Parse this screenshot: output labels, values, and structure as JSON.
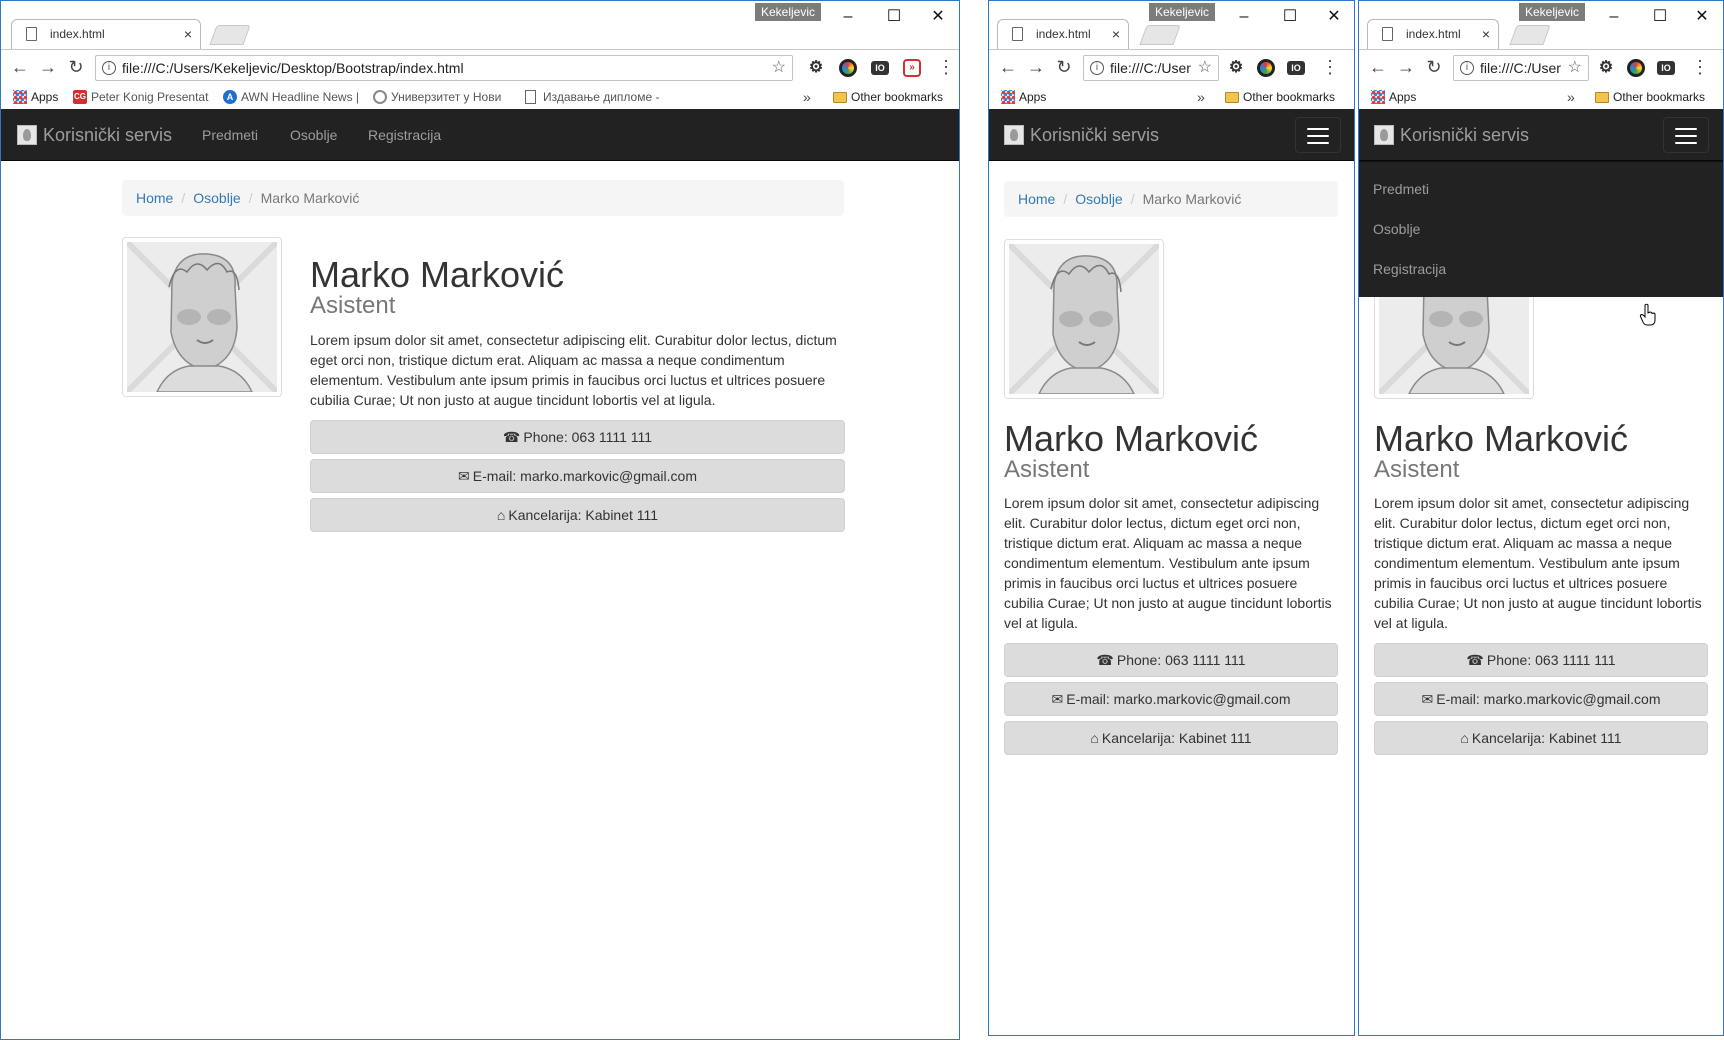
{
  "browser": {
    "profile_name": "Kekeljevic",
    "tab_title": "index.html",
    "url_full": "file:///C:/Users/Kekeljevic/Desktop/Bootstrap/index.html",
    "url_short": "file:///C:/User",
    "bookmarks": [
      "Apps",
      "Peter Konig Presentat",
      "AWN Headline News |",
      "Универзитет у Нови",
      "Издавање дипломе -"
    ],
    "other_bookmarks": "Other bookmarks",
    "more_chevron": "»"
  },
  "site": {
    "brand": "Korisnički servis",
    "nav": [
      "Predmeti",
      "Osoblje",
      "Registracija"
    ],
    "breadcrumb": [
      "Home",
      "Osoblje",
      "Marko Marković"
    ],
    "breadcrumb_separator": "/",
    "profile": {
      "name": "Marko Marković",
      "role": "Asistent",
      "bio": "Lorem ipsum dolor sit amet, consectetur adipiscing elit. Curabitur dolor lectus, dictum eget orci non, tristique dictum erat. Aliquam ac massa a neque condimentum elementum. Vestibulum ante ipsum primis in faucibus orci luctus et ultrices posuere cubilia Curae; Ut non justo at augue tincidunt lobortis vel at ligula.",
      "contacts": [
        {
          "icon": "phone-icon",
          "text": "Phone: 063 1111 111"
        },
        {
          "icon": "envelope-icon",
          "text": "E-mail: marko.markovic@gmail.com"
        },
        {
          "icon": "home-icon",
          "text": "Kancelarija: Kabinet 111"
        }
      ]
    }
  },
  "colors": {
    "navbar_bg": "#222222",
    "nav_link": "#9d9d9d",
    "link": "#337ab7",
    "button_bg": "#dcdcdc",
    "window_border": "#2b79c5"
  }
}
